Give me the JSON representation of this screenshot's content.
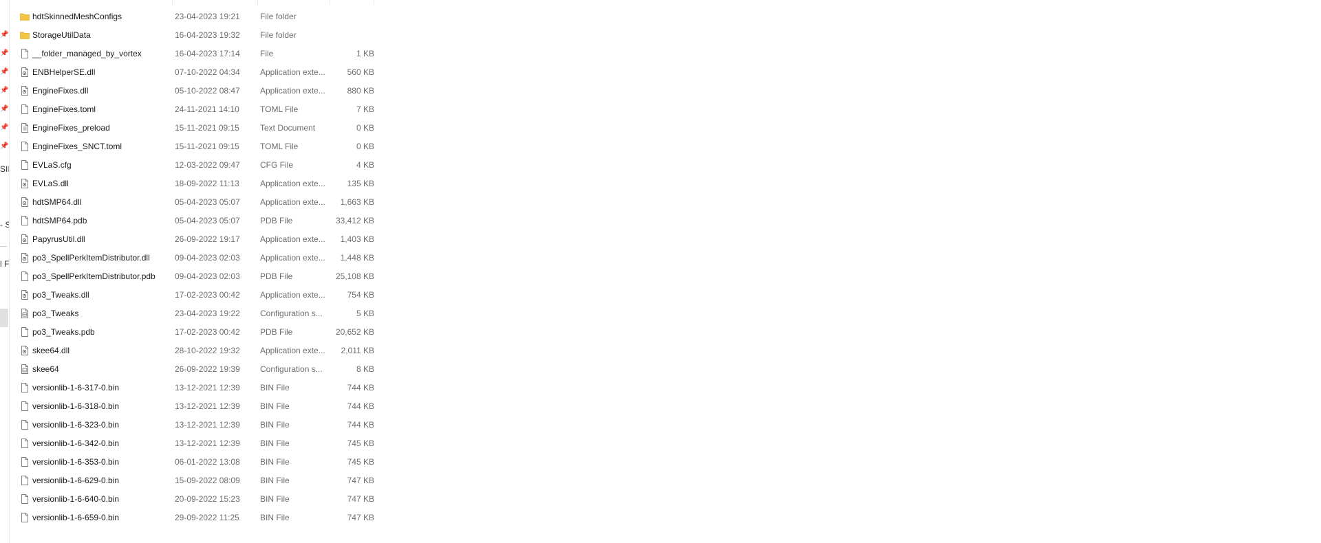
{
  "files": [
    {
      "name": "hdtSkinnedMeshConfigs",
      "date": "23-04-2023 19:21",
      "type": "File folder",
      "size": "",
      "icon": "folder-icon"
    },
    {
      "name": "StorageUtilData",
      "date": "16-04-2023 19:32",
      "type": "File folder",
      "size": "",
      "icon": "folder-icon"
    },
    {
      "name": "__folder_managed_by_vortex",
      "date": "16-04-2023 17:14",
      "type": "File",
      "size": "1 KB",
      "icon": "file-icon"
    },
    {
      "name": "ENBHelperSE.dll",
      "date": "07-10-2022 04:34",
      "type": "Application exte...",
      "size": "560 KB",
      "icon": "dll-icon"
    },
    {
      "name": "EngineFixes.dll",
      "date": "05-10-2022 08:47",
      "type": "Application exte...",
      "size": "880 KB",
      "icon": "dll-icon"
    },
    {
      "name": "EngineFixes.toml",
      "date": "24-11-2021 14:10",
      "type": "TOML File",
      "size": "7 KB",
      "icon": "file-icon"
    },
    {
      "name": "EngineFixes_preload",
      "date": "15-11-2021 09:15",
      "type": "Text Document",
      "size": "0 KB",
      "icon": "text-file-icon"
    },
    {
      "name": "EngineFixes_SNCT.toml",
      "date": "15-11-2021 09:15",
      "type": "TOML File",
      "size": "0 KB",
      "icon": "file-icon"
    },
    {
      "name": "EVLaS.cfg",
      "date": "12-03-2022 09:47",
      "type": "CFG File",
      "size": "4 KB",
      "icon": "file-icon"
    },
    {
      "name": "EVLaS.dll",
      "date": "18-09-2022 11:13",
      "type": "Application exte...",
      "size": "135 KB",
      "icon": "dll-icon"
    },
    {
      "name": "hdtSMP64.dll",
      "date": "05-04-2023 05:07",
      "type": "Application exte...",
      "size": "1,663 KB",
      "icon": "dll-icon"
    },
    {
      "name": "hdtSMP64.pdb",
      "date": "05-04-2023 05:07",
      "type": "PDB File",
      "size": "33,412 KB",
      "icon": "file-icon"
    },
    {
      "name": "PapyrusUtil.dll",
      "date": "26-09-2022 19:17",
      "type": "Application exte...",
      "size": "1,403 KB",
      "icon": "dll-icon"
    },
    {
      "name": "po3_SpellPerkItemDistributor.dll",
      "date": "09-04-2023 02:03",
      "type": "Application exte...",
      "size": "1,448 KB",
      "icon": "dll-icon"
    },
    {
      "name": "po3_SpellPerkItemDistributor.pdb",
      "date": "09-04-2023 02:03",
      "type": "PDB File",
      "size": "25,108 KB",
      "icon": "file-icon"
    },
    {
      "name": "po3_Tweaks.dll",
      "date": "17-02-2023 00:42",
      "type": "Application exte...",
      "size": "754 KB",
      "icon": "dll-icon"
    },
    {
      "name": "po3_Tweaks",
      "date": "23-04-2023 19:22",
      "type": "Configuration s...",
      "size": "5 KB",
      "icon": "config-file-icon"
    },
    {
      "name": "po3_Tweaks.pdb",
      "date": "17-02-2023 00:42",
      "type": "PDB File",
      "size": "20,652 KB",
      "icon": "file-icon"
    },
    {
      "name": "skee64.dll",
      "date": "28-10-2022 19:32",
      "type": "Application exte...",
      "size": "2,011 KB",
      "icon": "dll-icon"
    },
    {
      "name": "skee64",
      "date": "26-09-2022 19:39",
      "type": "Configuration s...",
      "size": "8 KB",
      "icon": "config-file-icon"
    },
    {
      "name": "versionlib-1-6-317-0.bin",
      "date": "13-12-2021 12:39",
      "type": "BIN File",
      "size": "744 KB",
      "icon": "file-icon"
    },
    {
      "name": "versionlib-1-6-318-0.bin",
      "date": "13-12-2021 12:39",
      "type": "BIN File",
      "size": "744 KB",
      "icon": "file-icon"
    },
    {
      "name": "versionlib-1-6-323-0.bin",
      "date": "13-12-2021 12:39",
      "type": "BIN File",
      "size": "744 KB",
      "icon": "file-icon"
    },
    {
      "name": "versionlib-1-6-342-0.bin",
      "date": "13-12-2021 12:39",
      "type": "BIN File",
      "size": "745 KB",
      "icon": "file-icon"
    },
    {
      "name": "versionlib-1-6-353-0.bin",
      "date": "06-01-2022 13:08",
      "type": "BIN File",
      "size": "745 KB",
      "icon": "file-icon"
    },
    {
      "name": "versionlib-1-6-629-0.bin",
      "date": "15-09-2022 08:09",
      "type": "BIN File",
      "size": "747 KB",
      "icon": "file-icon"
    },
    {
      "name": "versionlib-1-6-640-0.bin",
      "date": "20-09-2022 15:23",
      "type": "BIN File",
      "size": "747 KB",
      "icon": "file-icon"
    },
    {
      "name": "versionlib-1-6-659-0.bin",
      "date": "29-09-2022 11:25",
      "type": "BIN File",
      "size": "747 KB",
      "icon": "file-icon"
    }
  ],
  "nav_fragments": [
    "SII",
    "- S",
    "l F"
  ],
  "colors": {
    "folder": "#f4c542",
    "folder_tab": "#e0a82e",
    "icon_stroke": "#7a7a7a",
    "selection": "#e0e0e0"
  }
}
